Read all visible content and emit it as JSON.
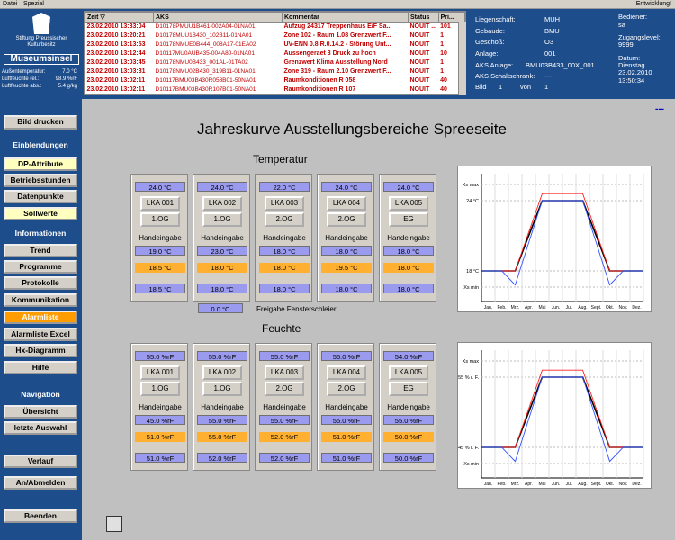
{
  "menubar": {
    "items": [
      "Datei",
      "Spezial"
    ],
    "right": "Entwicklung!"
  },
  "logo": {
    "org": "Stiftung Preussischer Kulturbesitz",
    "name": "Museumsinsel"
  },
  "sensors": [
    {
      "label": "Außentemperatur:",
      "value": "7.0 °C"
    },
    {
      "label": "Luftfeuchte rel.:",
      "value": "98.9 %rF"
    },
    {
      "label": "Luftfeuchte abs.:",
      "value": "5.4 g/kg"
    }
  ],
  "nav": {
    "print": "Bild drucken",
    "sec1": "Einblendungen",
    "dp": "DP-Attribute",
    "betrieb": "Betriebsstunden",
    "dpunkte": "Datenpunkte",
    "soll": "Sollwerte",
    "sec2": "Informationen",
    "trend": "Trend",
    "prog": "Programme",
    "proto": "Protokolle",
    "komm": "Kommunikation",
    "alarm": "Alarmliste",
    "alarmx": "Alarmliste Excel",
    "hx": "Hx-Diagramm",
    "hilfe": "Hilfe",
    "sec3": "Navigation",
    "ueber": "Übersicht",
    "letzte": "letzte Auswahl",
    "verlauf": "Verlauf",
    "anab": "An/Abmelden",
    "beenden": "Beenden"
  },
  "alarmtable": {
    "headers": [
      "Zeit",
      "AKS",
      "Kommentar",
      "Status",
      "Pri..."
    ],
    "rows": [
      [
        "23.02.2010 13:33:04",
        "D10178PMUU1B461-002A04-01NA01",
        "Aufzug 24317 Treppenhaus E/F Sa...",
        "NOUIT ...",
        "101"
      ],
      [
        "23.02.2010 13:20:21",
        "D10178MUU1B430_102B11-01NA01",
        "Zone 102 - Raum 1.08 Grenzwert F...",
        "NOUIT",
        "1"
      ],
      [
        "23.02.2010 13:13:53",
        "D10178NMUE0B444_008A17-01EA02",
        "UV-ENN 0.8 R.0.14.2 - Störung Unt...",
        "NOUIT",
        "1"
      ],
      [
        "23.02.2010 13:12:44",
        "D10117MU0AUB435-004A80-01NA01",
        "Aussengeraet 3 Druck zu hoch",
        "NOUIT",
        "10"
      ],
      [
        "23.02.2010 13:03:45",
        "D10178NMU0B433_001AL-01TA02",
        "Grenzwert Klima Ausstellung Nord",
        "NOUIT",
        "1"
      ],
      [
        "23.02.2010 13:03:31",
        "D10178NMU02B430_319B11-01NA01",
        "Zone 319 - Raum 2.10 Grenzwert F...",
        "NOUIT",
        "1"
      ],
      [
        "23.02.2010 13:02:11",
        "D10117BMU03B430R058B01-50NA01",
        "Raumkonditionen R 058",
        "NOUIT",
        "40"
      ],
      [
        "23.02.2010 13:02:11",
        "D10117BMU03B430R107B01-50NA01",
        "Raumkonditionen R 107",
        "NOUIT",
        "40"
      ]
    ]
  },
  "info": {
    "liegenschaft_l": "Liegenschaft:",
    "liegenschaft_v": "MUH",
    "gebaeude_l": "Gebaude:",
    "gebaeude_v": "BMU",
    "geschoss_l": "Geschoß:",
    "geschoss_v": "O3",
    "anlage_l": "Anlage:",
    "anlage_v": "001",
    "aks_l": "AKS Anlage:",
    "aks_v": "BMU03B433_00X_001",
    "schalt_l": "AKS Schaltschrank:",
    "schalt_v": "---",
    "bild_l": "Bild",
    "bild_v": "1",
    "von_l": "von",
    "von_v": "1",
    "bediener_l": "Bediener:",
    "bediener_v": "sa",
    "zugang_l": "Zugangslevel:",
    "zugang_v": "9999",
    "datum_l": "Datum:",
    "datum_day": "Dienstag",
    "datum_v": "23.02.2010",
    "zeit_v": "13:50:34"
  },
  "page": {
    "title": "Jahreskurve Ausstellungsbereiche Spreeseite",
    "dash": "---",
    "temp": "Temperatur",
    "feuchte": "Feuchte",
    "freigabe": "Freigabe Fensterschleier",
    "freigabe_val": "0.0 °C",
    "hand": "Handeingabe"
  },
  "temp_cards": [
    {
      "top": "24.0 °C",
      "name": "LKA 001",
      "floor": "1.OG",
      "hand": "19.0 °C",
      "or": "18.5 °C",
      "bot": "18.5 °C"
    },
    {
      "top": "24.0 °C",
      "name": "LKA 002",
      "floor": "1.OG",
      "hand": "23.0 °C",
      "or": "18.0 °C",
      "bot": "18.0 °C"
    },
    {
      "top": "22.0 °C",
      "name": "LKA 003",
      "floor": "2.OG",
      "hand": "18.0 °C",
      "or": "18.0 °C",
      "bot": "18.0 °C"
    },
    {
      "top": "24.0 °C",
      "name": "LKA 004",
      "floor": "2.OG",
      "hand": "18.0 °C",
      "or": "19.5 °C",
      "bot": "18.0 °C"
    },
    {
      "top": "24.0 °C",
      "name": "LKA 005",
      "floor": "EG",
      "hand": "18.0 °C",
      "or": "18.0 °C",
      "bot": "18.0 °C"
    }
  ],
  "hum_cards": [
    {
      "top": "55.0 %rF",
      "name": "LKA 001",
      "floor": "1.OG",
      "hand": "45.0 %rF",
      "or": "51.0 %rF",
      "bot": "51.0 %rF"
    },
    {
      "top": "55.0 %rF",
      "name": "LKA 002",
      "floor": "1.OG",
      "hand": "55.0 %rF",
      "or": "55.0 %rF",
      "bot": "52.0 %rF"
    },
    {
      "top": "55.0 %rF",
      "name": "LKA 003",
      "floor": "2.OG",
      "hand": "55.0 %rF",
      "or": "52.0 %rF",
      "bot": "52.0 %rF"
    },
    {
      "top": "55.0 %rF",
      "name": "LKA 004",
      "floor": "2.OG",
      "hand": "55.0 %rF",
      "or": "51.0 %rF",
      "bot": "51.0 %rF"
    },
    {
      "top": "54.0 %rF",
      "name": "LKA 005",
      "floor": "EG",
      "hand": "55.0 %rF",
      "or": "50.0 %rF",
      "bot": "50.0 %rF"
    }
  ],
  "chart_data": [
    {
      "type": "line",
      "months": [
        "Jan.",
        "Feb.",
        "Mrz.",
        "Apr.",
        "Mai",
        "Jun.",
        "Jul.",
        "Aug.",
        "Sept.",
        "Okt.",
        "Nov.",
        "Dez."
      ],
      "ylabels": [
        "Xs max",
        "24 °C",
        "18 °C",
        "Xs min"
      ],
      "series": [
        {
          "values": [
            0,
            0,
            0,
            0.5,
            1,
            1,
            1,
            1,
            0.5,
            0,
            0,
            0
          ],
          "color": "#000000"
        },
        {
          "values": [
            0,
            0,
            0,
            0.55,
            1.1,
            1.1,
            1.1,
            1.1,
            0.55,
            0,
            0,
            0
          ],
          "color": "#ff2020"
        },
        {
          "values": [
            0,
            0,
            -0.2,
            0.4,
            1,
            1,
            1,
            1,
            0.4,
            -0.2,
            0,
            0
          ],
          "color": "#3050ff"
        }
      ]
    },
    {
      "type": "line",
      "months": [
        "Jan.",
        "Feb.",
        "Mrz.",
        "Apr.",
        "Mai",
        "Jun.",
        "Jul.",
        "Aug.",
        "Sept.",
        "Okt.",
        "Nov.",
        "Dez."
      ],
      "ylabels": [
        "Xs max",
        "55 % r. F.",
        "45 % r. F.",
        "Xs min"
      ],
      "series": [
        {
          "values": [
            0,
            0,
            0,
            0.5,
            1,
            1,
            1,
            1,
            0.5,
            0,
            0,
            0
          ],
          "color": "#000000"
        },
        {
          "values": [
            0,
            0,
            0,
            0.55,
            1.1,
            1.1,
            1.1,
            1.1,
            0.55,
            0,
            0,
            0
          ],
          "color": "#ff2020"
        },
        {
          "values": [
            0,
            0,
            -0.2,
            0.4,
            1,
            1,
            1,
            1,
            0.4,
            -0.2,
            0,
            0
          ],
          "color": "#3050ff"
        }
      ]
    }
  ]
}
